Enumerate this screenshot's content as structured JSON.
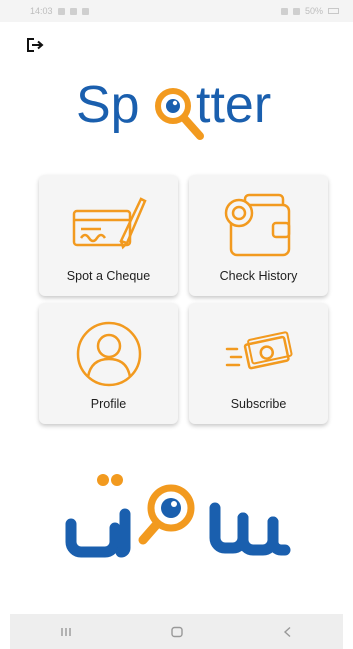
{
  "status_bar": {
    "time": "14:03",
    "battery": "50%"
  },
  "header": {
    "logout_icon": "logout-icon"
  },
  "logo": {
    "text_before": "Sp",
    "text_after": "tter",
    "urdu_text": "سپوٹر"
  },
  "tiles": [
    {
      "label": "Spot a Cheque",
      "icon": "cheque-pen-icon"
    },
    {
      "label": "Check History",
      "icon": "wallet-coin-icon"
    },
    {
      "label": "Profile",
      "icon": "person-icon"
    },
    {
      "label": "Subscribe",
      "icon": "money-icon"
    }
  ],
  "nav_bar": {
    "recents_icon": "recents-icon",
    "home_icon": "home-icon",
    "back_icon": "back-icon"
  },
  "colors": {
    "brand_blue": "#1a5fae",
    "brand_orange": "#f29a1f",
    "tile_bg": "#f5f5f5",
    "nav_bg": "#eeeeee"
  }
}
